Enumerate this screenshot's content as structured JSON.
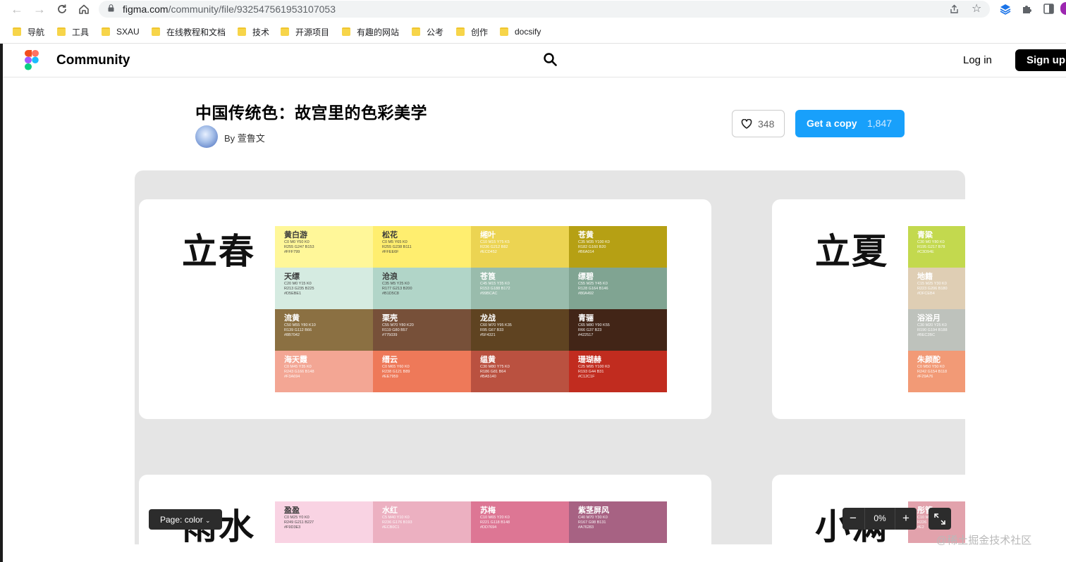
{
  "browser": {
    "url_host": "figma.com",
    "url_path": "/community/file/932547561953107053",
    "bookmarks": [
      "导航",
      "工具",
      "SXAU",
      "在线教程和文档",
      "技术",
      "开源项目",
      "有趣的网站",
      "公考",
      "创作",
      "docsify"
    ]
  },
  "header": {
    "brand": "Community",
    "login": "Log in",
    "signup": "Sign up"
  },
  "file": {
    "title": "中国传统色：故宫里的色彩美学",
    "by_prefix": "By",
    "author": "萱鲁文",
    "likes": "348",
    "copy_label": "Get a copy",
    "copy_count": "1,847"
  },
  "preview": {
    "cards": [
      {
        "season": "立春",
        "swatches": [
          {
            "name": "黄白游",
            "cmyk": "C0 M0 Y50 K0",
            "rgb": "R255 G247 B153",
            "hex": "#FFF799",
            "color": "#FFF799",
            "dark": true
          },
          {
            "name": "松花",
            "cmyk": "C0 M5 Y65 K0",
            "rgb": "R255 G238 B111",
            "hex": "#FFEE6F",
            "color": "#FFEE6F",
            "dark": true
          },
          {
            "name": "缃叶",
            "cmyk": "C10 M15 Y75 K5",
            "rgb": "R236 G212 B82",
            "hex": "#ECD452",
            "color": "#ECD452",
            "dark": false
          },
          {
            "name": "苍黄",
            "cmyk": "C35 M35 Y100 K0",
            "rgb": "R182 G160 B20",
            "hex": "#B6A014",
            "color": "#B6A014",
            "dark": false
          },
          {
            "name": "天缥",
            "cmyk": "C20 M0 Y15 K0",
            "rgb": "R213 G235 B225",
            "hex": "#D5EBE1",
            "color": "#D5EBE1",
            "dark": true
          },
          {
            "name": "沧浪",
            "cmyk": "C35 M5 Y25 K0",
            "rgb": "R177 G213 B200",
            "hex": "#B1D5C8",
            "color": "#B1D5C8",
            "dark": true
          },
          {
            "name": "苍筤",
            "cmyk": "C45 M15 Y35 K0",
            "rgb": "R153 G188 B172",
            "hex": "#99BCAC",
            "color": "#99BCAC",
            "dark": false
          },
          {
            "name": "缥碧",
            "cmyk": "C55 M25 Y45 K0",
            "rgb": "R128 G164 B146",
            "hex": "#80A492",
            "color": "#80A492",
            "dark": false
          },
          {
            "name": "流黄",
            "cmyk": "C50 M55 Y80 K10",
            "rgb": "R139 G112 B66",
            "hex": "#8B7042",
            "color": "#8B7042",
            "dark": false
          },
          {
            "name": "栗壳",
            "cmyk": "C55 M70 Y80 K20",
            "rgb": "R119 G80 B57",
            "hex": "#775039",
            "color": "#775039",
            "dark": false
          },
          {
            "name": "龙战",
            "cmyk": "C60 M70 Y95 K35",
            "rgb": "R95 G67 B33",
            "hex": "#5F4321",
            "color": "#5F4321",
            "dark": false
          },
          {
            "name": "青骊",
            "cmyk": "C65 M80 Y90 K55",
            "rgb": "R66 G37 B23",
            "hex": "#422517",
            "color": "#422517",
            "dark": false
          },
          {
            "name": "海天霞",
            "cmyk": "C0 M45 Y35 K0",
            "rgb": "R243 G166 B148",
            "hex": "#F3A694",
            "color": "#F3A694",
            "dark": false
          },
          {
            "name": "缙云",
            "cmyk": "C0 M65 Y60 K0",
            "rgb": "R238 G121 B89",
            "hex": "#EE7959",
            "color": "#EE7959",
            "dark": false
          },
          {
            "name": "缊黄",
            "cmyk": "C30 M80 Y75 K0",
            "rgb": "R186 G81 B64",
            "hex": "#BA5140",
            "color": "#BA5140",
            "dark": false
          },
          {
            "name": "珊瑚赫",
            "cmyk": "C25 M95 Y100 K0",
            "rgb": "R193 G44 B31",
            "hex": "#C12C1F",
            "color": "#C12C1F",
            "dark": false
          }
        ]
      },
      {
        "season": "立夏",
        "swatches": [
          {
            "name": "青粱",
            "cmyk": "C30 M0 Y80 K0",
            "rgb": "R195 G217 B78",
            "hex": "#C3D94E",
            "color": "#C3D94E",
            "dark": false
          },
          {
            "name": "地籍",
            "cmyk": "C15 M25 Y30 K0",
            "rgb": "R223 G206 B180",
            "hex": "#DFCEB4",
            "color": "#DFCEB4",
            "dark": false
          },
          {
            "name": "浴浴月",
            "cmyk": "C30 M20 Y25 K0",
            "rgb": "R190 G194 B188",
            "hex": "#BEC2BC",
            "color": "#BEC2BC",
            "dark": false
          },
          {
            "name": "朱颜酡",
            "cmyk": "C0 M50 Y50 K0",
            "rgb": "R242 G154 B118",
            "hex": "#F29A76",
            "color": "#F29A76",
            "dark": false
          }
        ]
      },
      {
        "season": "雨水",
        "swatches": [
          {
            "name": "盈盈",
            "cmyk": "C0 M25 Y0 K0",
            "rgb": "R249 G211 B227",
            "hex": "#F9D3E3",
            "color": "#F9D3E3",
            "dark": true
          },
          {
            "name": "水红",
            "cmyk": "C5 M40 Y10 K0",
            "rgb": "R236 G176 B193",
            "hex": "#ECB0C1",
            "color": "#ECB0C1",
            "dark": false
          },
          {
            "name": "苏梅",
            "cmyk": "C10 M65 Y20 K0",
            "rgb": "R221 G118 B148",
            "hex": "#DD7694",
            "color": "#DD7694",
            "dark": false
          },
          {
            "name": "紫茎屏风",
            "cmyk": "C40 M70 Y30 K0",
            "rgb": "R167 G98 B131",
            "hex": "#A76283",
            "color": "#A76283",
            "dark": false
          }
        ]
      },
      {
        "season": "小满",
        "swatches": [
          {
            "name": "彤管",
            "cmyk": "C10 M",
            "rgb": "R226",
            "hex": "#E2",
            "color": "#E2A2AC",
            "dark": false
          }
        ]
      }
    ],
    "page_selector": "Page: color",
    "zoom": "0%"
  },
  "watermark": "@稀土掘金技术社区",
  "colors": {
    "figma_blue": "#18A0FB",
    "canvas_bg": "#E5E5E5",
    "toolbar_dark": "#2C2C2C"
  }
}
